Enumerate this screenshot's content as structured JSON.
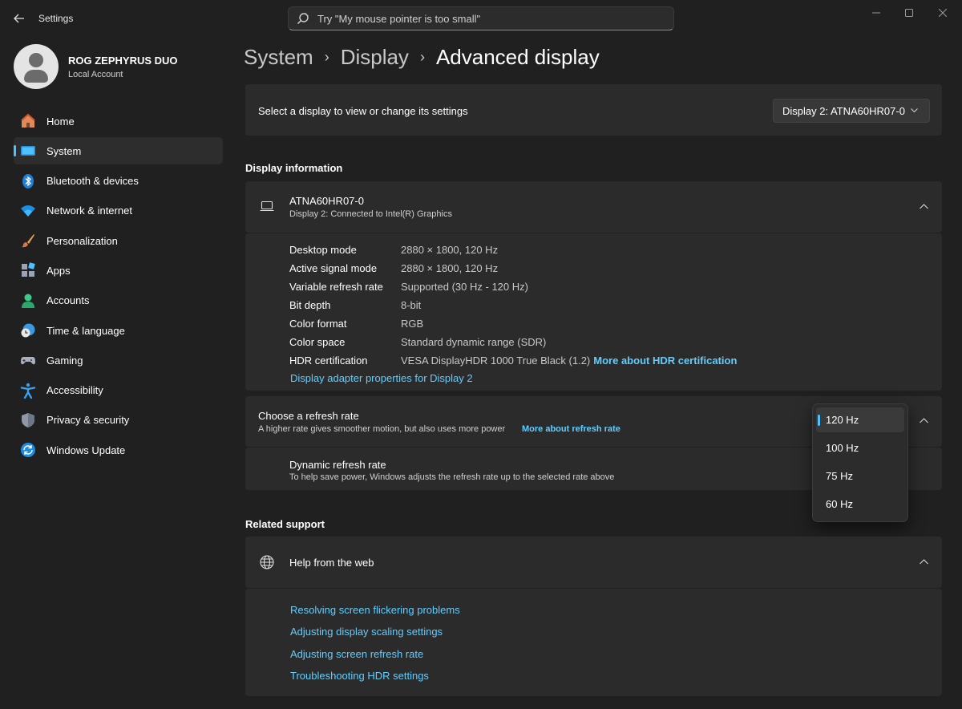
{
  "window": {
    "title": "Settings",
    "search_placeholder": "Try \"My mouse pointer is too small\""
  },
  "profile": {
    "name": "ROG ZEPHYRUS DUO",
    "account": "Local Account"
  },
  "sidebar": {
    "items": [
      {
        "label": "Home",
        "icon": "home-icon"
      },
      {
        "label": "System",
        "icon": "system-icon",
        "selected": true
      },
      {
        "label": "Bluetooth & devices",
        "icon": "bluetooth-icon"
      },
      {
        "label": "Network & internet",
        "icon": "wifi-icon"
      },
      {
        "label": "Personalization",
        "icon": "brush-icon"
      },
      {
        "label": "Apps",
        "icon": "apps-icon"
      },
      {
        "label": "Accounts",
        "icon": "person-icon"
      },
      {
        "label": "Time & language",
        "icon": "clock-globe-icon"
      },
      {
        "label": "Gaming",
        "icon": "gamepad-icon"
      },
      {
        "label": "Accessibility",
        "icon": "accessibility-icon"
      },
      {
        "label": "Privacy & security",
        "icon": "shield-icon"
      },
      {
        "label": "Windows Update",
        "icon": "update-icon"
      }
    ]
  },
  "breadcrumb": {
    "item1": "System",
    "item2": "Display",
    "current": "Advanced display"
  },
  "select_display": {
    "label": "Select a display to view or change its settings",
    "value": "Display 2: ATNA60HR07-0"
  },
  "display_info": {
    "section_title": "Display information",
    "monitor_name": "ATNA60HR07-0",
    "monitor_sub": "Display 2: Connected to Intel(R) Graphics",
    "rows": [
      {
        "label": "Desktop mode",
        "value": "2880 × 1800, 120 Hz"
      },
      {
        "label": "Active signal mode",
        "value": "2880 × 1800, 120 Hz"
      },
      {
        "label": "Variable refresh rate",
        "value": "Supported (30 Hz - 120 Hz)"
      },
      {
        "label": "Bit depth",
        "value": "8-bit"
      },
      {
        "label": "Color format",
        "value": "RGB"
      },
      {
        "label": "Color space",
        "value": "Standard dynamic range (SDR)"
      },
      {
        "label": "HDR certification",
        "value": "VESA DisplayHDR 1000 True Black (1.2)"
      }
    ],
    "hdr_link": "More about HDR certification",
    "adapter_link": "Display adapter properties for Display 2"
  },
  "refresh_rate": {
    "title": "Choose a refresh rate",
    "subtitle": "A higher rate gives smoother motion, but also uses more power",
    "link": "More about refresh rate",
    "options": [
      "120 Hz",
      "100 Hz",
      "75 Hz",
      "60 Hz"
    ],
    "selected": "120 Hz",
    "dynamic_title": "Dynamic refresh rate",
    "dynamic_sub": "To help save power, Windows adjusts the refresh rate up to the selected rate above"
  },
  "related_support": {
    "section_title": "Related support",
    "help_title": "Help from the web",
    "links": [
      "Resolving screen flickering problems",
      "Adjusting display scaling settings",
      "Adjusting screen refresh rate",
      "Troubleshooting HDR settings"
    ]
  },
  "colors": {
    "accent": "#4cc2ff",
    "link": "#60cdff",
    "background": "#202020",
    "card": "#2b2b2b"
  }
}
